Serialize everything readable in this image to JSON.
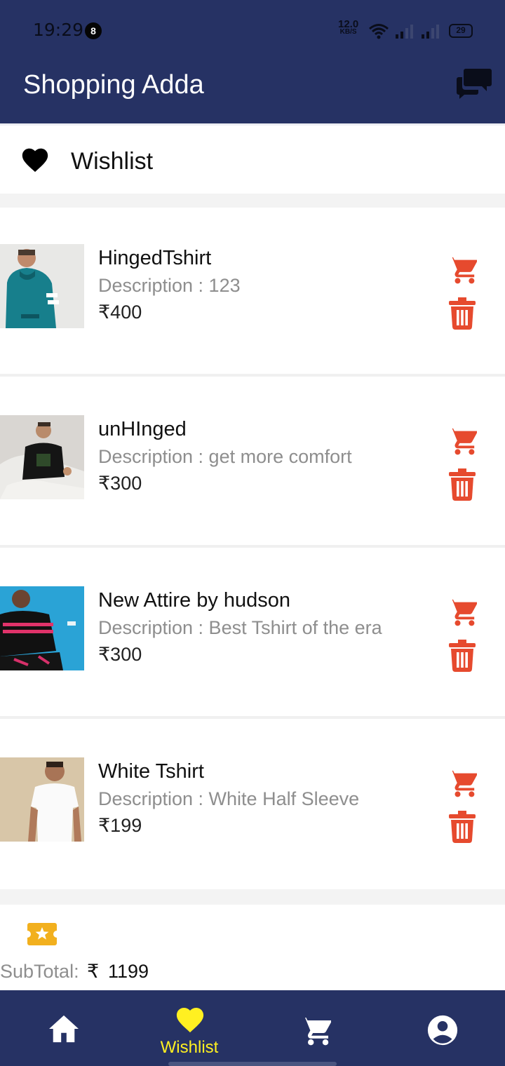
{
  "status_bar": {
    "time": "19:29",
    "notification_count": "8",
    "net_speed": "12.0",
    "net_speed_unit": "KB/S",
    "battery": "29"
  },
  "app_bar": {
    "title": "Shopping Adda",
    "chat_icon": "chat-bubbles-icon"
  },
  "section": {
    "icon": "heart-icon",
    "title": "Wishlist"
  },
  "items": [
    {
      "name": "HingedTshirt",
      "description": "Description : 123",
      "price": "₹400",
      "image": "teal hoodie model"
    },
    {
      "name": "unHInged",
      "description": "Description : get more comfort",
      "price": "₹300",
      "image": "black tshirt model"
    },
    {
      "name": "New Attire by hudson",
      "description": "Description : Best Tshirt of the era",
      "price": "₹300",
      "image": "striped tshirt model"
    },
    {
      "name": "White Tshirt",
      "description": "Description : White Half Sleeve",
      "price": "₹199",
      "image": "white tshirt model"
    }
  ],
  "summary": {
    "label": "SubTotal:",
    "currency": "₹",
    "total": "1199"
  },
  "bottom_nav": [
    {
      "label": "",
      "icon": "home-icon",
      "active": false
    },
    {
      "label": "Wishlist",
      "icon": "heart-icon",
      "active": true
    },
    {
      "label": "",
      "icon": "cart-icon",
      "active": false
    },
    {
      "label": "",
      "icon": "account-icon",
      "active": false
    }
  ],
  "colors": {
    "primary": "#263264",
    "accent": "#E64A2E",
    "active_nav": "#FFF021",
    "ticket": "#F2B01E"
  }
}
